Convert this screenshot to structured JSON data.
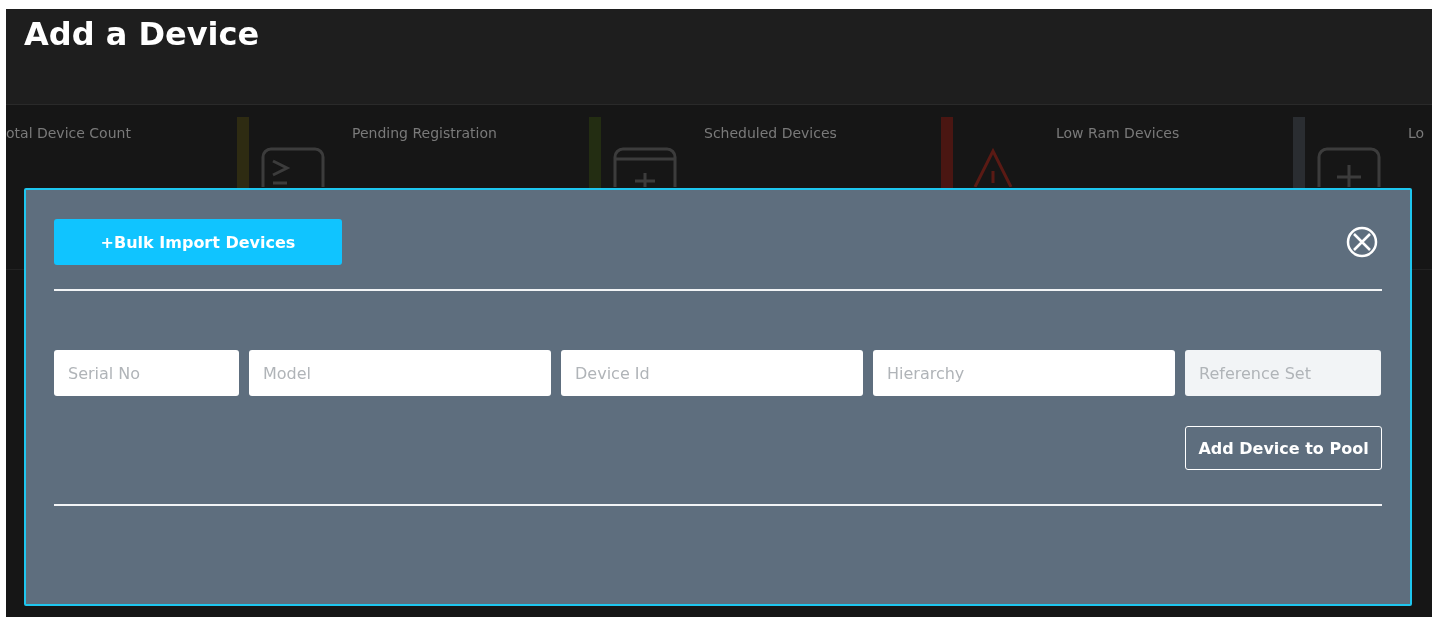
{
  "page": {
    "title": "Add a Device"
  },
  "stats": [
    {
      "label": "otal Device Count",
      "kind": "none"
    },
    {
      "label": "Pending Registration",
      "color": "#2e2b12",
      "kind": "terminal"
    },
    {
      "label": "Scheduled Devices",
      "color": "#232d12",
      "kind": "window"
    },
    {
      "label": "Low Ram Devices",
      "color": "#4a1612",
      "kind": "warning"
    },
    {
      "label": "Lo",
      "color": "#2a2d31",
      "kind": "plus"
    }
  ],
  "modal": {
    "bulk_button": "+Bulk Import Devices",
    "fields": [
      {
        "placeholder": "Serial No",
        "disabled": false
      },
      {
        "placeholder": "Model",
        "disabled": false
      },
      {
        "placeholder": "Device Id",
        "disabled": false
      },
      {
        "placeholder": "Hierarchy",
        "disabled": false
      },
      {
        "placeholder": "Reference Set",
        "disabled": true
      }
    ],
    "add_button": "Add Device to Pool"
  }
}
